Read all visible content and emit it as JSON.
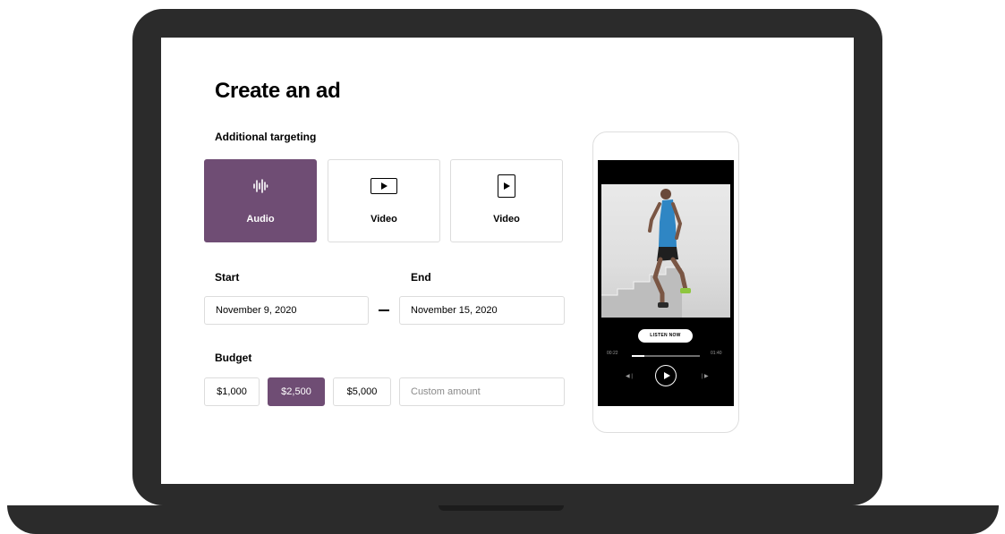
{
  "form": {
    "title": "Create an ad",
    "targeting_label": "Additional targeting",
    "targeting_options": [
      {
        "label": "Audio",
        "icon": "audio-wave-icon",
        "selected": true
      },
      {
        "label": "Video",
        "icon": "video-landscape-icon",
        "selected": false
      },
      {
        "label": "Video",
        "icon": "video-portrait-icon",
        "selected": false
      }
    ],
    "start_label": "Start",
    "end_label": "End",
    "start_date": "November 9, 2020",
    "end_date": "November 15, 2020",
    "budget_label": "Budget",
    "budget_options": [
      "$1,000",
      "$2,500",
      "$5,000"
    ],
    "selected_budget": "$2,500",
    "custom_placeholder": "Custom amount"
  },
  "preview": {
    "cta_label": "LISTEN NOW",
    "elapsed": "00:22",
    "duration": "01:40",
    "progress": 0.18
  },
  "colors": {
    "accent": "#6f4d74",
    "device": "#2b2b2b",
    "border": "#dcdcdc"
  }
}
